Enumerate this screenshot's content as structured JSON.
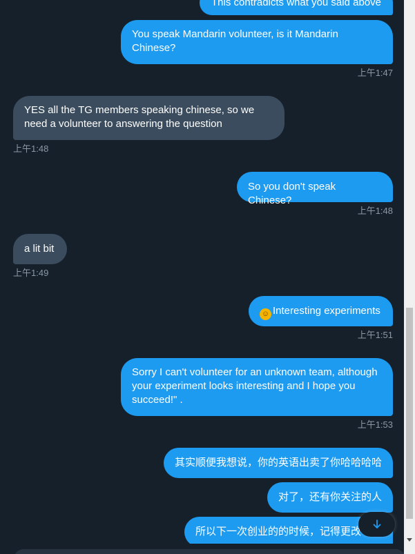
{
  "messages": [
    {
      "text": "This contradicts what you said above"
    },
    {
      "text": "You speak Mandarin volunteer, is it Mandarin Chinese?",
      "time": "上午1:47"
    },
    {
      "text": "YES all the TG members speaking chinese, so we need a volunteer to answering the question",
      "time": "上午1:48"
    },
    {
      "text": "So you don't speak Chinese?",
      "time": "上午1:48"
    },
    {
      "text": "a lit bit",
      "time": "上午1:49"
    },
    {
      "text": "Interesting experiments",
      "emoji": "rolling-on-the-floor-laughing",
      "time": "上午1:51"
    },
    {
      "text": "Sorry I can't volunteer for an unknown team, although your experiment looks interesting and I hope you succeed!\" .",
      "time": "上午1:53"
    },
    {
      "text": "其实顺便我想说，你的英语出卖了你哈哈哈哈"
    },
    {
      "text": "对了，还有你关注的人"
    },
    {
      "text": "所以下一次创业的的时候，记得更改"
    }
  ],
  "colors": {
    "background": "#15202b",
    "outgoing": "#1d9bf0",
    "incoming": "#3a4c5d",
    "timestamp": "#8b98a5"
  },
  "icons": {
    "scroll_down": "arrow-down-icon"
  }
}
